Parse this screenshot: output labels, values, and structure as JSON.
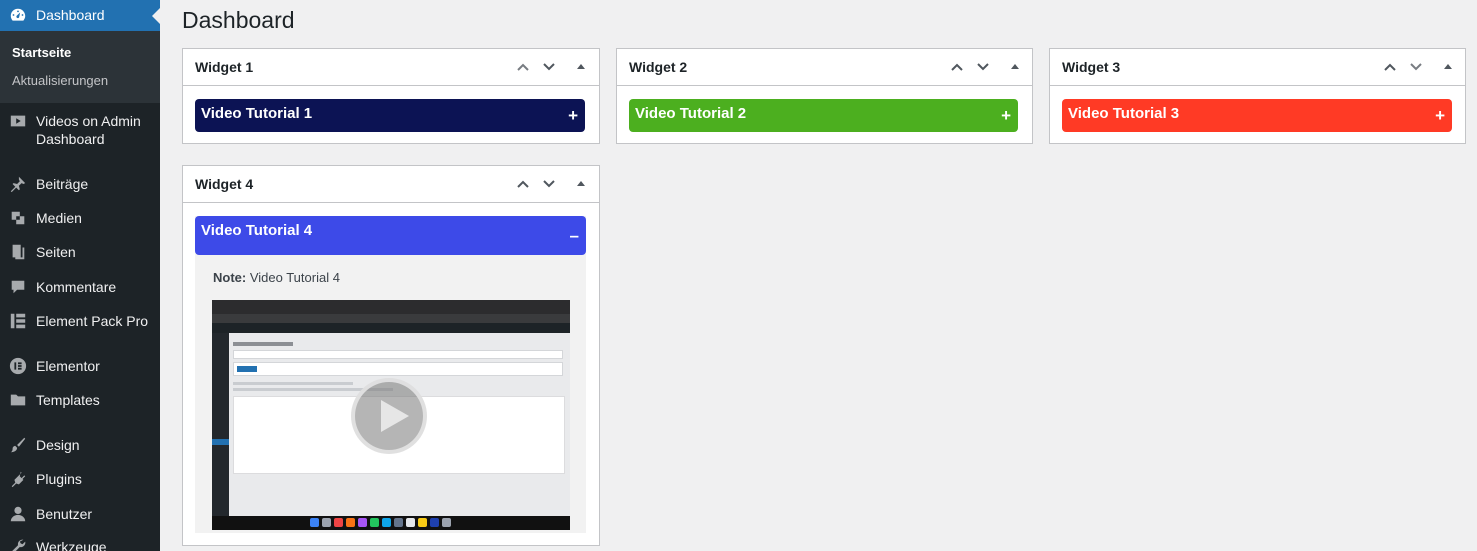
{
  "page": {
    "title": "Dashboard"
  },
  "sidebar": {
    "dashboard": "Dashboard",
    "submenu": [
      "Startseite",
      "Aktualisierungen"
    ],
    "items": [
      {
        "label": "Videos on Admin Dashboard",
        "icon": "video-icon"
      },
      {
        "label": "Beiträge",
        "icon": "pin-icon"
      },
      {
        "label": "Medien",
        "icon": "media-icon"
      },
      {
        "label": "Seiten",
        "icon": "pages-icon"
      },
      {
        "label": "Kommentare",
        "icon": "comment-icon"
      },
      {
        "label": "Element Pack Pro",
        "icon": "element-pack-icon"
      },
      {
        "label": "Elementor",
        "icon": "elementor-icon"
      },
      {
        "label": "Templates",
        "icon": "folder-icon"
      },
      {
        "label": "Design",
        "icon": "brush-icon"
      },
      {
        "label": "Plugins",
        "icon": "plugin-icon"
      },
      {
        "label": "Benutzer",
        "icon": "user-icon"
      },
      {
        "label": "Werkzeuge",
        "icon": "wrench-icon"
      }
    ]
  },
  "widgets": [
    {
      "title": "Widget 1",
      "tutorial": "Video Tutorial 1",
      "toggle": "+",
      "color": "#0c1354"
    },
    {
      "title": "Widget 2",
      "tutorial": "Video Tutorial 2",
      "toggle": "+",
      "color": "#4caf1f"
    },
    {
      "title": "Widget 3",
      "tutorial": "Video Tutorial 3",
      "toggle": "+",
      "color": "#ff3a25"
    },
    {
      "title": "Widget 4",
      "tutorial": "Video Tutorial 4",
      "toggle": "–",
      "color": "#3d4ae8",
      "note_label": "Note:",
      "note_text": " Video Tutorial 4"
    }
  ],
  "colors": {
    "sidebar_bg": "#1d2327",
    "active": "#2271b1"
  }
}
